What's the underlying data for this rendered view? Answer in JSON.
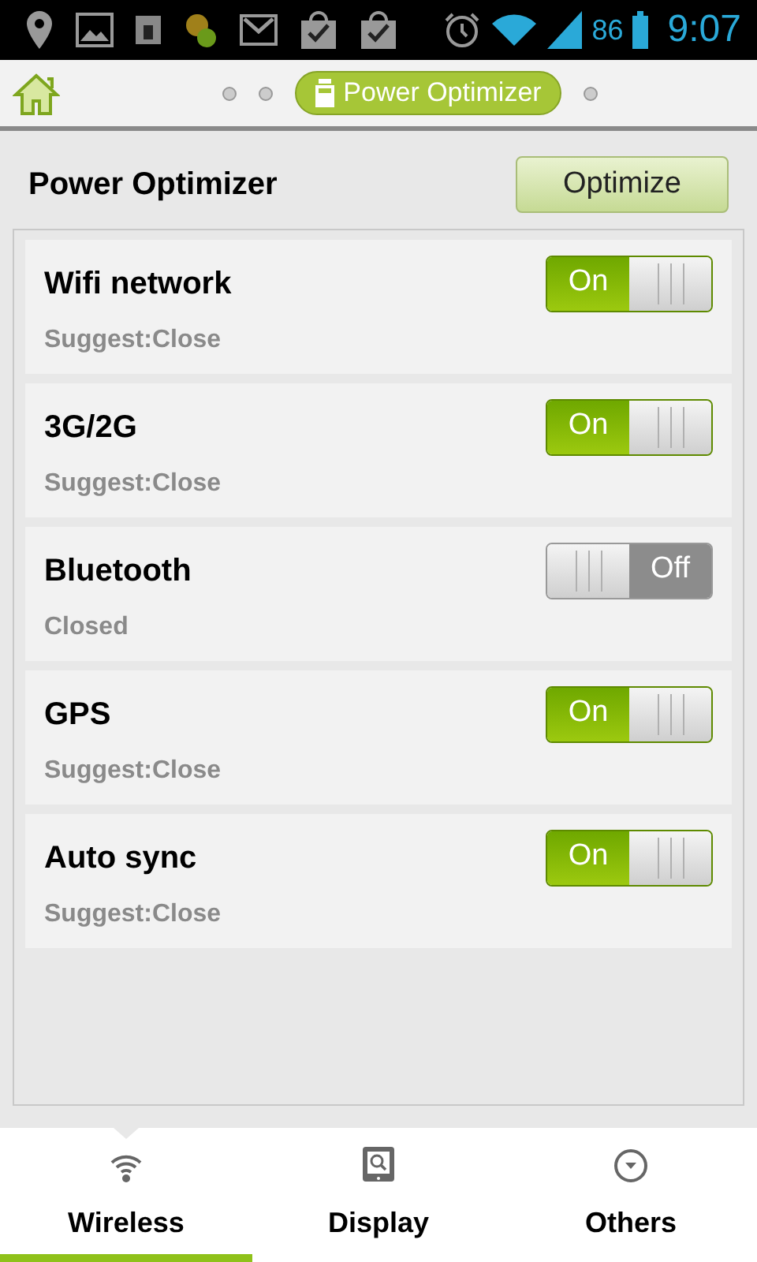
{
  "status_bar": {
    "battery_percent": "86",
    "time": "9:07"
  },
  "header": {
    "pages": [
      {
        "selected": false
      },
      {
        "selected": false
      },
      {
        "selected": true,
        "label": "Power Optimizer"
      },
      {
        "selected": false
      }
    ]
  },
  "title": "Power Optimizer",
  "optimize_button": "Optimize",
  "items": [
    {
      "name": "Wifi network",
      "status": "Suggest:Close",
      "on": true,
      "switch_label": "On"
    },
    {
      "name": "3G/2G",
      "status": "Suggest:Close",
      "on": true,
      "switch_label": "On"
    },
    {
      "name": "Bluetooth",
      "status": "Closed",
      "on": false,
      "switch_label": "Off"
    },
    {
      "name": "GPS",
      "status": "Suggest:Close",
      "on": true,
      "switch_label": "On"
    },
    {
      "name": "Auto sync",
      "status": "Suggest:Close",
      "on": true,
      "switch_label": "On"
    }
  ],
  "tabs": [
    {
      "label": "Wireless",
      "kind": "wifi",
      "selected": true
    },
    {
      "label": "Display",
      "kind": "tablet",
      "selected": false
    },
    {
      "label": "Others",
      "kind": "circle",
      "selected": false
    }
  ]
}
